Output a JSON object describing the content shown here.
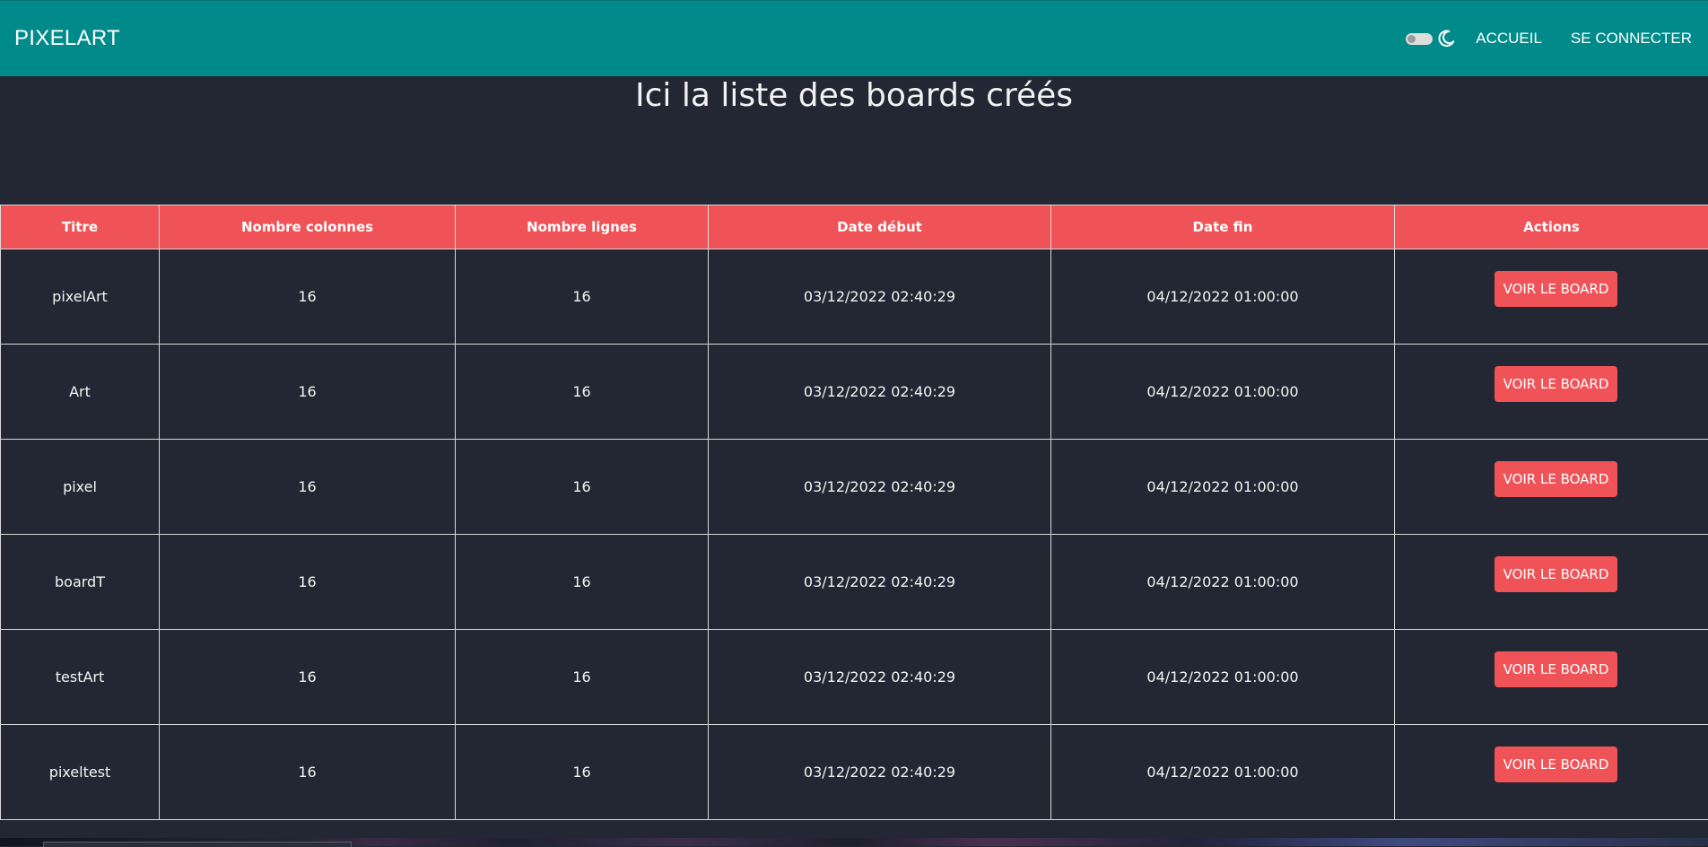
{
  "navbar": {
    "brand": "PIXELART",
    "theme_toggle_icon": "toggle-switch",
    "theme_icon": "moon-icon",
    "links": [
      "ACCUEIL",
      "SE CONNECTER"
    ],
    "background": "#008b8a"
  },
  "page": {
    "title": "Ici la liste des boards créés"
  },
  "table": {
    "headers": [
      "Titre",
      "Nombre colonnes",
      "Nombre lignes",
      "Date début",
      "Date fin",
      "Actions"
    ],
    "action_label": "VOIR LE BOARD",
    "header_color": "#f05357",
    "rows": [
      {
        "titre": "pixelArt",
        "colonnes": "16",
        "lignes": "16",
        "debut": "03/12/2022 02:40:29",
        "fin": "04/12/2022 01:00:00"
      },
      {
        "titre": "Art",
        "colonnes": "16",
        "lignes": "16",
        "debut": "03/12/2022 02:40:29",
        "fin": "04/12/2022 01:00:00"
      },
      {
        "titre": "pixel",
        "colonnes": "16",
        "lignes": "16",
        "debut": "03/12/2022 02:40:29",
        "fin": "04/12/2022 01:00:00"
      },
      {
        "titre": "boardT",
        "colonnes": "16",
        "lignes": "16",
        "debut": "03/12/2022 02:40:29",
        "fin": "04/12/2022 01:00:00"
      },
      {
        "titre": "testArt",
        "colonnes": "16",
        "lignes": "16",
        "debut": "03/12/2022 02:40:29",
        "fin": "04/12/2022 01:00:00"
      },
      {
        "titre": "pixeltest",
        "colonnes": "16",
        "lignes": "16",
        "debut": "03/12/2022 02:40:29",
        "fin": "04/12/2022 01:00:00"
      }
    ]
  }
}
